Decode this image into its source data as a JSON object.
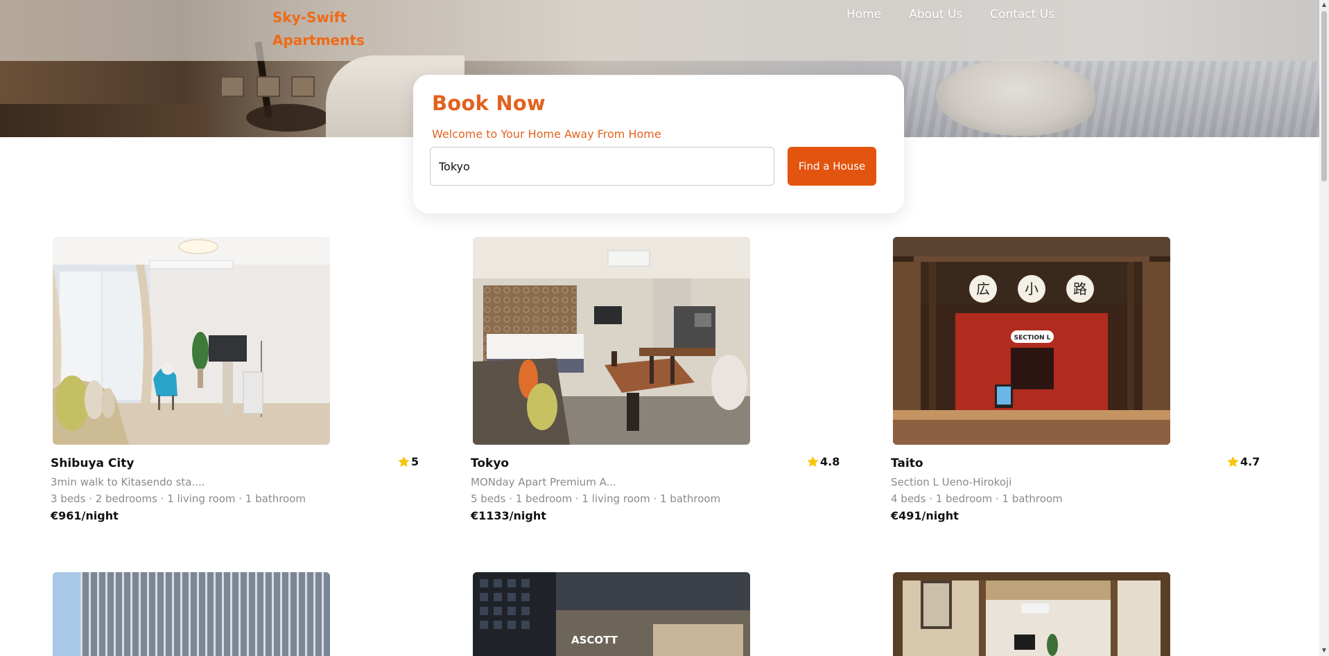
{
  "brand": {
    "name": "Sky-Swift Apartments"
  },
  "nav": {
    "items": [
      {
        "label": "Home"
      },
      {
        "label": "About Us"
      },
      {
        "label": "Contact Us"
      }
    ]
  },
  "booking": {
    "title": "Book Now",
    "subtitle": "Welcome to Your Home Away From Home",
    "search_value": "Tokyo",
    "button_label": "Find a House"
  },
  "listings": [
    {
      "title": "Shibuya City",
      "rating": "5",
      "description": "3min walk to Kitasendo sta....",
      "details": "3 beds · 2 bedrooms · 1 living room · 1 bathroom",
      "price": "€961/night"
    },
    {
      "title": "Tokyo",
      "rating": "4.8",
      "description": "MONday Apart Premium A...",
      "details": "5 beds · 1 bedroom · 1 living room · 1 bathroom",
      "price": "€1133/night"
    },
    {
      "title": "Taito",
      "rating": "4.7",
      "description": "Section L Ueno-Hirokoji",
      "details": "4 beds · 1 bedroom · 1 bathroom",
      "price": "€491/night"
    }
  ],
  "images": {
    "taito_sign_chars": [
      "広",
      "小",
      "路"
    ],
    "taito_section_label": "SECTION L",
    "ascott_label": "ASCOTT"
  },
  "colors": {
    "brand": "#ef6a18",
    "accent": "#e3540f",
    "star": "#f7c50c"
  }
}
